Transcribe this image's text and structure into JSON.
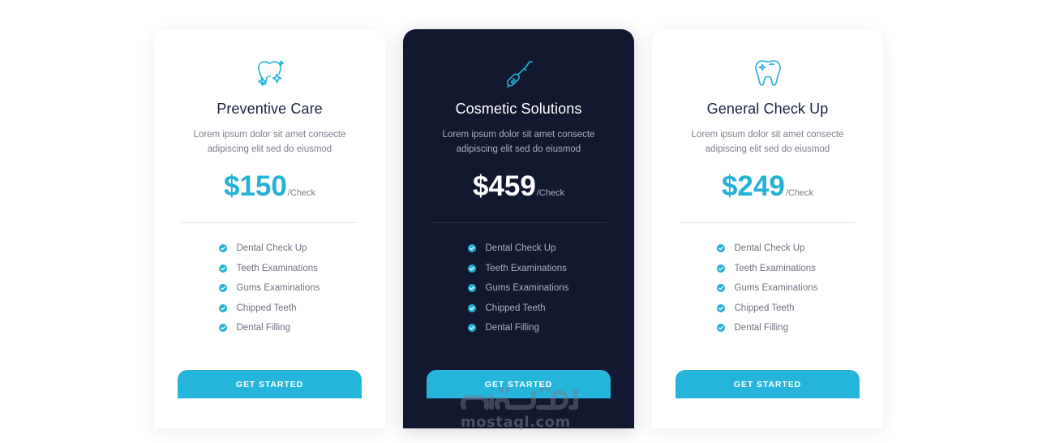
{
  "colors": {
    "accent": "#24b1d8",
    "dark_card": "#121830",
    "title": "#1b2340",
    "muted": "#7a7f8c"
  },
  "plans": [
    {
      "icon": "sparkling-tooth-icon",
      "title": "Preventive Care",
      "description": "Lorem ipsum dolor sit amet consecte adipiscing elit sed do eiusmod",
      "price": "$150",
      "period": "/Check",
      "features": [
        "Dental Check Up",
        "Teeth Examinations",
        "Gums Examinations",
        "Chipped Teeth",
        "Dental Filling"
      ],
      "button": "GET STARTED",
      "highlighted": false
    },
    {
      "icon": "dental-drill-icon",
      "title": "Cosmetic Solutions",
      "description": "Lorem ipsum dolor sit amet consecte adipiscing elit sed do eiusmod",
      "price": "$459",
      "period": "/Check",
      "features": [
        "Dental Check Up",
        "Teeth Examinations",
        "Gums Examinations",
        "Chipped Teeth",
        "Dental Filling"
      ],
      "button": "GET STARTED",
      "highlighted": true
    },
    {
      "icon": "clean-tooth-icon",
      "title": "General Check Up",
      "description": "Lorem ipsum dolor sit amet consecte adipiscing elit sed do eiusmod",
      "price": "$249",
      "period": "/Check",
      "features": [
        "Dental Check Up",
        "Teeth Examinations",
        "Gums Examinations",
        "Chipped Teeth",
        "Dental Filling"
      ],
      "button": "GET STARTED",
      "highlighted": false
    }
  ],
  "watermark": {
    "text": "mostaql.com",
    "arabic": "مستقل"
  }
}
